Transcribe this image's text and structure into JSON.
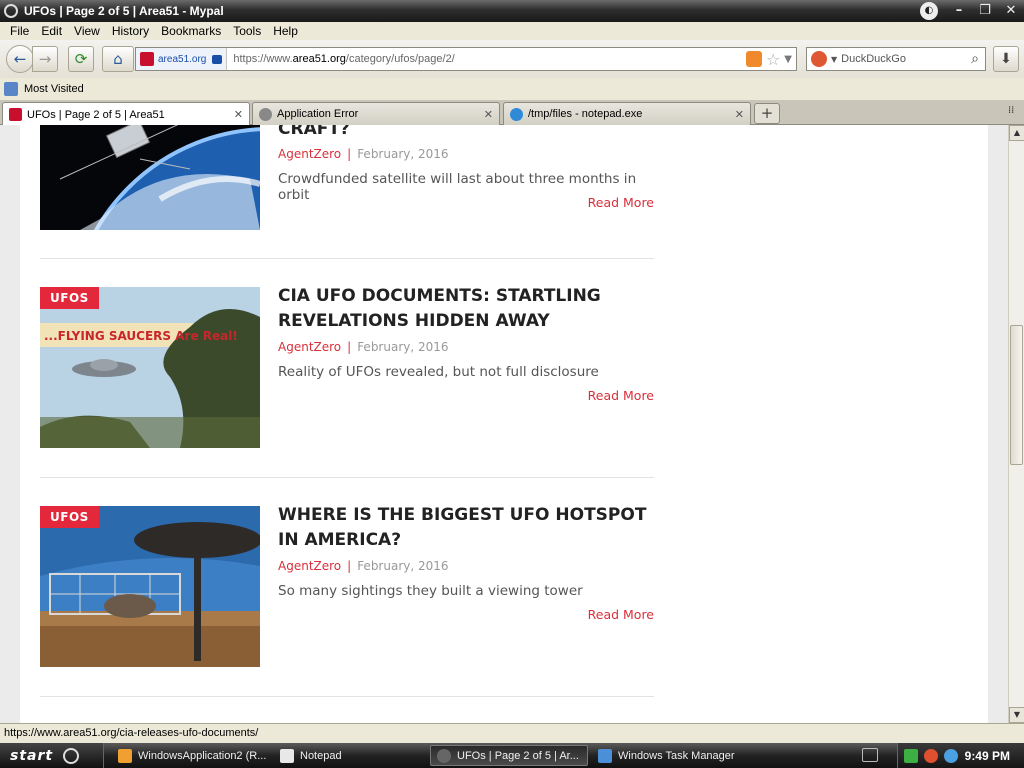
{
  "window": {
    "title": "UFOs | Page 2 of 5 | Area51 - Mypal"
  },
  "menu": [
    "File",
    "Edit",
    "View",
    "History",
    "Bookmarks",
    "Tools",
    "Help"
  ],
  "nav": {
    "site_identity": "area51.org",
    "url_prefix": "https://www.",
    "url_domain": "area51.org",
    "url_path": "/category/ufos/page/2/",
    "search_placeholder": "DuckDuckGo"
  },
  "bookmarks": {
    "most_visited": "Most Visited"
  },
  "tabs": [
    {
      "label": "UFOs | Page 2 of 5 | Area51",
      "active": true
    },
    {
      "label": "Application Error",
      "active": false
    },
    {
      "label": "/tmp/files - notepad.exe",
      "active": false
    }
  ],
  "articles": [
    {
      "category": "",
      "title": "CRAFT?",
      "author": "AgentZero",
      "date": "February, 2016",
      "excerpt": "Crowdfunded satellite will last about three months in orbit",
      "read_more": "Read More"
    },
    {
      "category": "UFOS",
      "title": "CIA UFO DOCUMENTS: STARTLING REVELATIONS HIDDEN AWAY",
      "author": "AgentZero",
      "date": "February, 2016",
      "excerpt": "Reality of UFOs revealed, but not full disclosure",
      "read_more": "Read More",
      "image_text": "...FLYING SAUCERS Are Real!"
    },
    {
      "category": "UFOS",
      "title": "WHERE IS THE BIGGEST UFO HOTSPOT IN AMERICA?",
      "author": "AgentZero",
      "date": "February, 2016",
      "excerpt": "So many sightings they built a viewing tower",
      "read_more": "Read More"
    }
  ],
  "meta_separator": "|",
  "status": {
    "link_url": "https://www.area51.org/cia-releases-ufo-documents/"
  },
  "taskbar": {
    "start_label": "start",
    "buttons": [
      {
        "label": "WindowsApplication2 (R...",
        "active": false
      },
      {
        "label": "Notepad",
        "active": false
      },
      {
        "label": "UFOs | Page 2 of 5 | Ar...",
        "active": true
      },
      {
        "label": "Windows Task Manager",
        "active": false
      }
    ],
    "clock": "9:49 PM"
  },
  "colors": {
    "accent": "#e3283b",
    "link": "#d9303a"
  }
}
